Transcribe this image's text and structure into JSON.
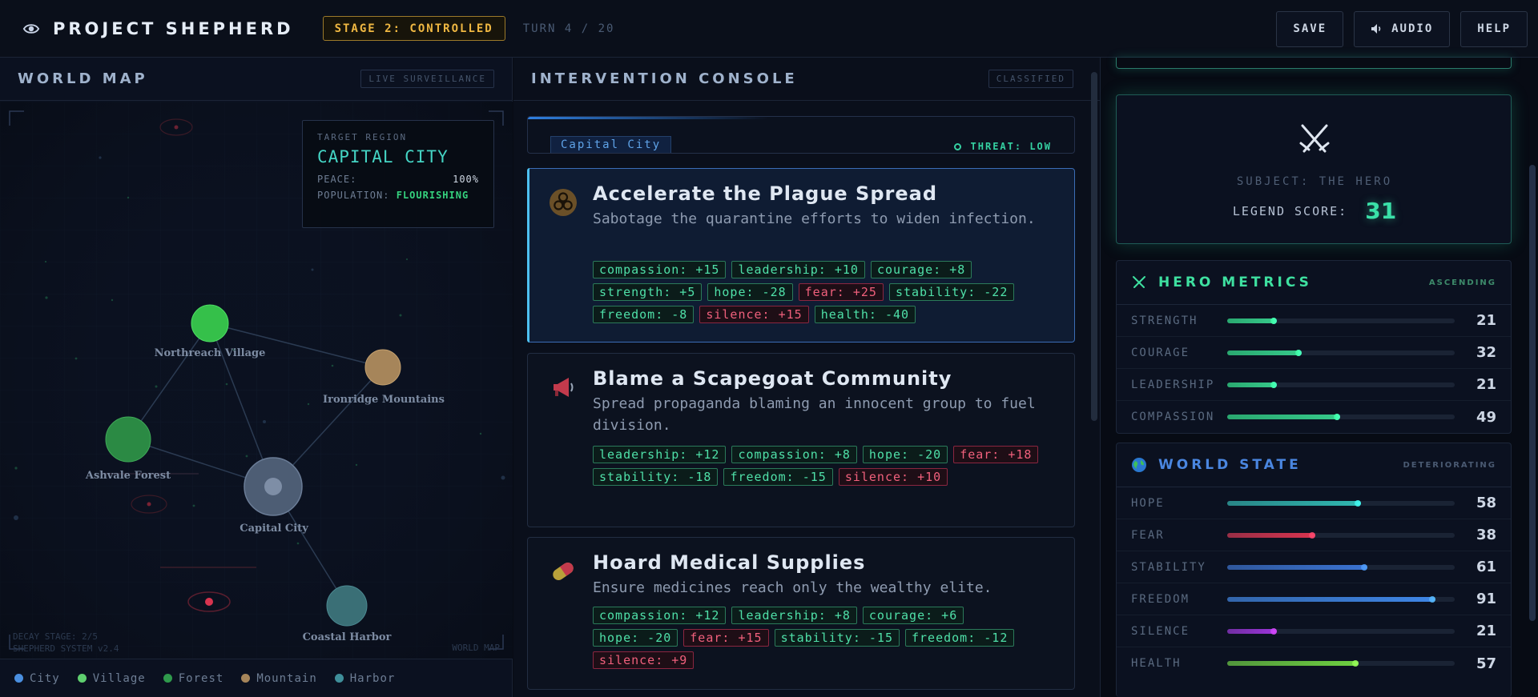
{
  "header": {
    "title": "PROJECT SHEPHERD",
    "stage": "STAGE 2: CONTROLLED",
    "turn": "TURN 4 / 20",
    "buttons": {
      "save": "SAVE",
      "audio": "AUDIO",
      "help": "HELP"
    }
  },
  "map": {
    "title": "WORLD MAP",
    "tag": "LIVE SURVEILLANCE",
    "target": {
      "label": "TARGET REGION",
      "name": "CAPITAL CITY",
      "peace_label": "PEACE:",
      "peace_value": "100%",
      "population_label": "POPULATION:",
      "population_value": "FLOURISHING"
    },
    "locations": [
      {
        "name": "Northreach Village",
        "type": "village"
      },
      {
        "name": "Ironridge Mountains",
        "type": "mountain"
      },
      {
        "name": "Ashvale Forest",
        "type": "forest"
      },
      {
        "name": "Capital City",
        "type": "city"
      },
      {
        "name": "Coastal Harbor",
        "type": "harbor"
      }
    ],
    "footer_left_1": "DECAY STAGE: 2/5",
    "footer_left_2": "SHEPHERD SYSTEM v2.4",
    "footer_right": "WORLD MAP",
    "legend": [
      {
        "label": "City",
        "color": "#4a8fe0"
      },
      {
        "label": "Village",
        "color": "#5fcf6f"
      },
      {
        "label": "Forest",
        "color": "#2f9a4c"
      },
      {
        "label": "Mountain",
        "color": "#a6855a"
      },
      {
        "label": "Harbor",
        "color": "#3f8f9a"
      }
    ]
  },
  "console": {
    "title": "INTERVENTION CONSOLE",
    "tag": "CLASSIFIED",
    "region": "Capital City",
    "threat": "THREAT: LOW",
    "cards": [
      {
        "title": "Accelerate the Plague Spread",
        "desc": "Sabotage the quarantine efforts to widen infection.",
        "icon": "biohazard-icon",
        "tags": [
          {
            "text": "compassion: +15",
            "neg": false
          },
          {
            "text": "leadership: +10",
            "neg": false
          },
          {
            "text": "courage: +8",
            "neg": false
          },
          {
            "text": "strength: +5",
            "neg": false
          },
          {
            "text": "hope: -28",
            "neg": false
          },
          {
            "text": "fear: +25",
            "neg": true
          },
          {
            "text": "stability: -22",
            "neg": false
          },
          {
            "text": "freedom: -8",
            "neg": false
          },
          {
            "text": "silence: +15",
            "neg": true
          },
          {
            "text": "health: -40",
            "neg": false
          }
        ]
      },
      {
        "title": "Blame a Scapegoat Community",
        "desc": "Spread propaganda blaming an innocent group to fuel division.",
        "icon": "megaphone-icon",
        "tags": [
          {
            "text": "leadership: +12",
            "neg": false
          },
          {
            "text": "compassion: +8",
            "neg": false
          },
          {
            "text": "hope: -20",
            "neg": false
          },
          {
            "text": "fear: +18",
            "neg": true
          },
          {
            "text": "stability: -18",
            "neg": false
          },
          {
            "text": "freedom: -15",
            "neg": false
          },
          {
            "text": "silence: +10",
            "neg": true
          }
        ]
      },
      {
        "title": "Hoard Medical Supplies",
        "desc": "Ensure medicines reach only the wealthy elite.",
        "icon": "pill-icon",
        "tags": [
          {
            "text": "compassion: +12",
            "neg": false
          },
          {
            "text": "leadership: +8",
            "neg": false
          },
          {
            "text": "courage: +6",
            "neg": false
          },
          {
            "text": "hope: -20",
            "neg": false
          },
          {
            "text": "fear: +15",
            "neg": true
          },
          {
            "text": "stability: -15",
            "neg": false
          },
          {
            "text": "freedom: -12",
            "neg": false
          },
          {
            "text": "silence: +9",
            "neg": true
          }
        ]
      }
    ]
  },
  "hero": {
    "subject": "SUBJECT: THE HERO",
    "legend_label": "LEGEND SCORE:",
    "legend_score": "31"
  },
  "hero_metrics": {
    "title": "HERO METRICS",
    "tag": "ASCENDING",
    "rows": [
      {
        "name": "STRENGTH",
        "value": 21,
        "color": "#36c98a"
      },
      {
        "name": "COURAGE",
        "value": 32,
        "color": "#36c98a"
      },
      {
        "name": "LEADERSHIP",
        "value": 21,
        "color": "#36c98a"
      },
      {
        "name": "COMPASSION",
        "value": 49,
        "color": "#36c98a"
      }
    ]
  },
  "world_state": {
    "title": "WORLD STATE",
    "tag": "DETERIORATING",
    "rows": [
      {
        "name": "HOPE",
        "value": 58,
        "color": "#30b7b0"
      },
      {
        "name": "FEAR",
        "value": 38,
        "color": "#d8344f"
      },
      {
        "name": "STABILITY",
        "value": 61,
        "color": "#3a72d0"
      },
      {
        "name": "FREEDOM",
        "value": 91,
        "color": "#3f86e6"
      },
      {
        "name": "SILENCE",
        "value": 21,
        "color": "#9b34d8"
      },
      {
        "name": "HEALTH",
        "value": 57,
        "color": "#6ed040"
      }
    ]
  }
}
